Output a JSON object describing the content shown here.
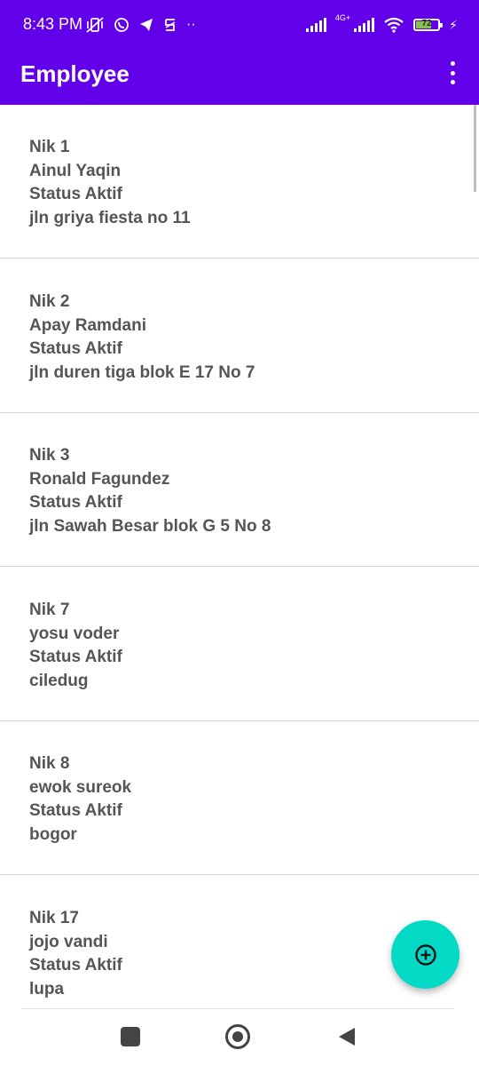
{
  "status_bar": {
    "time": "8:43 PM",
    "network_label": "4G+",
    "battery_level": "72",
    "battery_percent": 72
  },
  "app_bar": {
    "title": "Employee"
  },
  "employees": [
    {
      "nik": "Nik 1",
      "name": "Ainul Yaqin",
      "status": "Status Aktif",
      "address": "jln griya fiesta no 11"
    },
    {
      "nik": "Nik 2",
      "name": "Apay Ramdani",
      "status": "Status Aktif",
      "address": "jln duren tiga blok E 17 No 7"
    },
    {
      "nik": "Nik 3",
      "name": "Ronald Fagundez",
      "status": "Status Aktif",
      "address": "jln Sawah Besar blok G 5 No 8"
    },
    {
      "nik": "Nik 7",
      "name": "yosu voder",
      "status": "Status Aktif",
      "address": "ciledug"
    },
    {
      "nik": "Nik 8",
      "name": "ewok sureok",
      "status": "Status Aktif",
      "address": "bogor"
    },
    {
      "nik": "Nik 17",
      "name": "jojo vandi",
      "status": "Status Aktif",
      "address": "lupa"
    }
  ],
  "fab": {
    "icon": "add-circle-icon"
  },
  "colors": {
    "primary": "#6200ea",
    "fab": "#03dac5",
    "item_text": "#555555"
  }
}
